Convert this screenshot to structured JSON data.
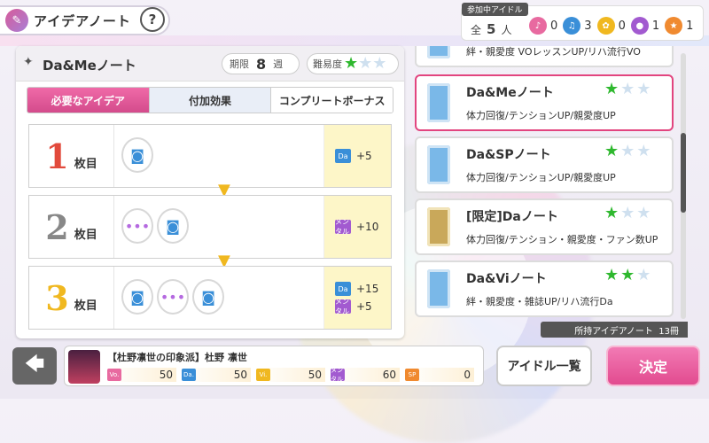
{
  "header": {
    "title": "アイデアノート",
    "help": "?"
  },
  "idols": {
    "label": "参加中アイドル",
    "total_prefix": "全",
    "total": "5",
    "total_suffix": "人",
    "types": [
      {
        "icon": "vocal-icon",
        "color": "#e86aa0",
        "count": "0"
      },
      {
        "icon": "dance-icon",
        "color": "#3a8fd8",
        "count": "3"
      },
      {
        "icon": "visual-icon",
        "color": "#f0b820",
        "count": "0"
      },
      {
        "icon": "mental-icon",
        "color": "#a25ad0",
        "count": "1"
      },
      {
        "icon": "special-icon",
        "color": "#f08a30",
        "count": "1"
      }
    ]
  },
  "note": {
    "name": "Da&Meノート",
    "deadline_label": "期限",
    "deadline_value": "8",
    "deadline_unit": "週",
    "difficulty_label": "難易度",
    "difficulty_stars": 1,
    "difficulty_max": 3
  },
  "tabs": [
    {
      "label": "必要なアイデア",
      "active": true
    },
    {
      "label": "付加効果",
      "active": false
    },
    {
      "label": "コンプリートボーナス",
      "active": false
    }
  ],
  "levels": [
    {
      "num": "1",
      "suffix": "枚目",
      "ideas": [
        "speaker"
      ],
      "bonus": [
        {
          "type": "Da",
          "value": "+5"
        }
      ]
    },
    {
      "num": "2",
      "suffix": "枚目",
      "ideas": [
        "chat",
        "speaker"
      ],
      "bonus": [
        {
          "type": "メンタル",
          "value": "+10"
        }
      ]
    },
    {
      "num": "3",
      "suffix": "枚目",
      "ideas": [
        "speaker",
        "chat",
        "speaker"
      ],
      "bonus": [
        {
          "type": "Da",
          "value": "+15"
        },
        {
          "type": "メンタル",
          "value": "+5"
        }
      ]
    }
  ],
  "cards": [
    {
      "name": "",
      "desc": "絆・親愛度 VOレッスンUP/リハ流行VO",
      "stars": 0,
      "selected": false,
      "gold": false
    },
    {
      "name": "Da&Meノート",
      "desc": "体力回復/テンションUP/親愛度UP",
      "stars": 1,
      "selected": true,
      "gold": false
    },
    {
      "name": "Da&SPノート",
      "desc": "体力回復/テンションUP/親愛度UP",
      "stars": 1,
      "selected": false,
      "gold": false
    },
    {
      "name": "[限定]Daノート",
      "desc": "体力回復/テンション・親愛度・ファン数UP",
      "stars": 1,
      "selected": false,
      "gold": true
    },
    {
      "name": "Da&Viノート",
      "desc": "絆・親愛度・雑誌UP/リハ流行Da",
      "stars": 2,
      "selected": false,
      "gold": false
    }
  ],
  "owned": {
    "label": "所持アイデアノート",
    "count": "13冊"
  },
  "idol": {
    "name": "【杜野凛世の印象派】杜野 凛世",
    "stats": [
      {
        "type": "Vo.",
        "value": "50"
      },
      {
        "type": "Da.",
        "value": "50"
      },
      {
        "type": "Vi.",
        "value": "50"
      },
      {
        "type": "メンタル",
        "value": "60"
      },
      {
        "type": "SP",
        "value": "0"
      }
    ]
  },
  "buttons": {
    "idol_list": "アイドル一覧",
    "decide": "決定"
  }
}
